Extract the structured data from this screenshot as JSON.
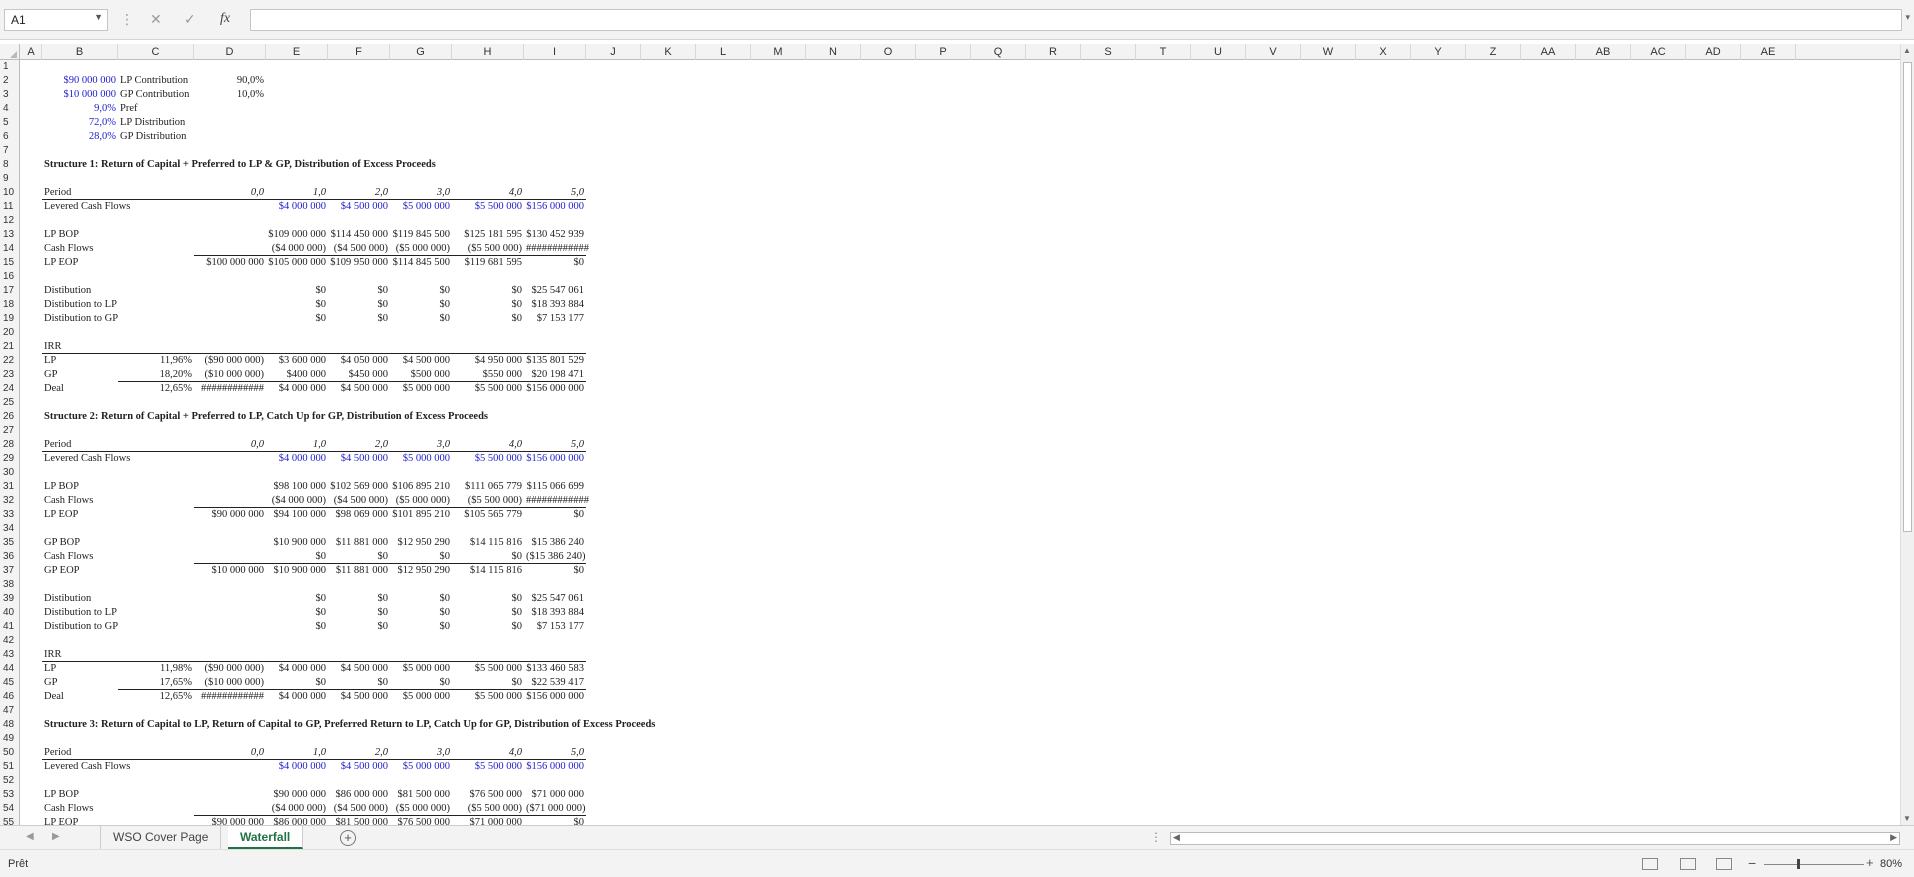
{
  "formula_bar": {
    "name_box": "A1",
    "fx": "fx",
    "formula": ""
  },
  "columns": [
    "A",
    "B",
    "C",
    "D",
    "E",
    "F",
    "G",
    "H",
    "I",
    "J",
    "K",
    "L",
    "M",
    "N",
    "O",
    "P",
    "Q",
    "R",
    "S",
    "T",
    "U",
    "V",
    "W",
    "X",
    "Y",
    "Z",
    "AA",
    "AB",
    "AC",
    "AD",
    "AE"
  ],
  "rows": [
    "1",
    "2",
    "3",
    "4",
    "5",
    "6",
    "7",
    "8",
    "9",
    "10",
    "11",
    "12",
    "13",
    "14",
    "15",
    "16",
    "17",
    "18",
    "19",
    "20",
    "21",
    "22",
    "23",
    "24",
    "25",
    "26",
    "27",
    "28",
    "29",
    "30",
    "31",
    "32",
    "33",
    "34",
    "35",
    "36",
    "37",
    "38",
    "39",
    "40",
    "41",
    "42",
    "43",
    "44",
    "45",
    "46",
    "47",
    "48",
    "49",
    "50",
    "51",
    "52",
    "53",
    "54",
    "55"
  ],
  "cells": [
    {
      "r": 2,
      "col": "B",
      "v": "$90 000 000",
      "cls": "num blue"
    },
    {
      "r": 2,
      "col": "C",
      "v": "LP Contribution"
    },
    {
      "r": 2,
      "col": "D",
      "v": "90,0%",
      "cls": "num"
    },
    {
      "r": 3,
      "col": "B",
      "v": "$10 000 000",
      "cls": "num blue"
    },
    {
      "r": 3,
      "col": "C",
      "v": "GP Contribution"
    },
    {
      "r": 3,
      "col": "D",
      "v": "10,0%",
      "cls": "num"
    },
    {
      "r": 4,
      "col": "B",
      "v": "9,0%",
      "cls": "num blue"
    },
    {
      "r": 4,
      "col": "C",
      "v": "Pref"
    },
    {
      "r": 5,
      "col": "B",
      "v": "72,0%",
      "cls": "num blue"
    },
    {
      "r": 5,
      "col": "C",
      "v": "LP Distribution"
    },
    {
      "r": 6,
      "col": "B",
      "v": "28,0%",
      "cls": "num blue"
    },
    {
      "r": 6,
      "col": "C",
      "v": "GP Distribution"
    },
    {
      "r": 8,
      "col": "B",
      "v": "Structure 1: Return of Capital + Preferred to LP & GP, Distribution of Excess Proceeds",
      "cls": "title"
    },
    {
      "r": 10,
      "col": "B",
      "v": "Period"
    },
    {
      "r": 10,
      "col": "D",
      "v": "0,0",
      "cls": "num it"
    },
    {
      "r": 10,
      "col": "E",
      "v": "1,0",
      "cls": "num it"
    },
    {
      "r": 10,
      "col": "F",
      "v": "2,0",
      "cls": "num it"
    },
    {
      "r": 10,
      "col": "G",
      "v": "3,0",
      "cls": "num it"
    },
    {
      "r": 10,
      "col": "H",
      "v": "4,0",
      "cls": "num it"
    },
    {
      "r": 10,
      "col": "I",
      "v": "5,0",
      "cls": "num it"
    },
    {
      "r": 11,
      "col": "B",
      "v": "Levered Cash Flows"
    },
    {
      "r": 11,
      "col": "E",
      "v": "$4 000 000",
      "cls": "num blue"
    },
    {
      "r": 11,
      "col": "F",
      "v": "$4 500 000",
      "cls": "num blue"
    },
    {
      "r": 11,
      "col": "G",
      "v": "$5 000 000",
      "cls": "num blue"
    },
    {
      "r": 11,
      "col": "H",
      "v": "$5 500 000",
      "cls": "num blue"
    },
    {
      "r": 11,
      "col": "I",
      "v": "$156 000 000",
      "cls": "num blue"
    },
    {
      "r": 13,
      "col": "B",
      "v": "LP BOP"
    },
    {
      "r": 13,
      "col": "E",
      "v": "$109 000 000",
      "cls": "num"
    },
    {
      "r": 13,
      "col": "F",
      "v": "$114 450 000",
      "cls": "num"
    },
    {
      "r": 13,
      "col": "G",
      "v": "$119 845 500",
      "cls": "num"
    },
    {
      "r": 13,
      "col": "H",
      "v": "$125 181 595",
      "cls": "num"
    },
    {
      "r": 13,
      "col": "I",
      "v": "$130 452 939",
      "cls": "num"
    },
    {
      "r": 14,
      "col": "B",
      "v": "Cash Flows"
    },
    {
      "r": 14,
      "col": "E",
      "v": "($4 000 000)",
      "cls": "num"
    },
    {
      "r": 14,
      "col": "F",
      "v": "($4 500 000)",
      "cls": "num"
    },
    {
      "r": 14,
      "col": "G",
      "v": "($5 000 000)",
      "cls": "num"
    },
    {
      "r": 14,
      "col": "H",
      "v": "($5 500 000)",
      "cls": "num"
    },
    {
      "r": 14,
      "col": "I",
      "v": "############",
      "cls": "num"
    },
    {
      "r": 15,
      "col": "B",
      "v": "LP EOP"
    },
    {
      "r": 15,
      "col": "D",
      "v": "$100 000 000",
      "cls": "num"
    },
    {
      "r": 15,
      "col": "E",
      "v": "$105 000 000",
      "cls": "num"
    },
    {
      "r": 15,
      "col": "F",
      "v": "$109 950 000",
      "cls": "num"
    },
    {
      "r": 15,
      "col": "G",
      "v": "$114 845 500",
      "cls": "num"
    },
    {
      "r": 15,
      "col": "H",
      "v": "$119 681 595",
      "cls": "num"
    },
    {
      "r": 15,
      "col": "I",
      "v": "$0",
      "cls": "num"
    },
    {
      "r": 17,
      "col": "B",
      "v": "Distibution"
    },
    {
      "r": 17,
      "col": "E",
      "v": "$0",
      "cls": "num"
    },
    {
      "r": 17,
      "col": "F",
      "v": "$0",
      "cls": "num"
    },
    {
      "r": 17,
      "col": "G",
      "v": "$0",
      "cls": "num"
    },
    {
      "r": 17,
      "col": "H",
      "v": "$0",
      "cls": "num"
    },
    {
      "r": 17,
      "col": "I",
      "v": "$25 547 061",
      "cls": "num"
    },
    {
      "r": 18,
      "col": "B",
      "v": "Distibution to LP"
    },
    {
      "r": 18,
      "col": "E",
      "v": "$0",
      "cls": "num"
    },
    {
      "r": 18,
      "col": "F",
      "v": "$0",
      "cls": "num"
    },
    {
      "r": 18,
      "col": "G",
      "v": "$0",
      "cls": "num"
    },
    {
      "r": 18,
      "col": "H",
      "v": "$0",
      "cls": "num"
    },
    {
      "r": 18,
      "col": "I",
      "v": "$18 393 884",
      "cls": "num"
    },
    {
      "r": 19,
      "col": "B",
      "v": "Distibution to GP"
    },
    {
      "r": 19,
      "col": "E",
      "v": "$0",
      "cls": "num"
    },
    {
      "r": 19,
      "col": "F",
      "v": "$0",
      "cls": "num"
    },
    {
      "r": 19,
      "col": "G",
      "v": "$0",
      "cls": "num"
    },
    {
      "r": 19,
      "col": "H",
      "v": "$0",
      "cls": "num"
    },
    {
      "r": 19,
      "col": "I",
      "v": "$7 153 177",
      "cls": "num"
    },
    {
      "r": 21,
      "col": "B",
      "v": "IRR"
    },
    {
      "r": 22,
      "col": "B",
      "v": "LP"
    },
    {
      "r": 22,
      "col": "C",
      "v": "11,96%",
      "cls": "num"
    },
    {
      "r": 22,
      "col": "D",
      "v": "($90 000 000)",
      "cls": "num"
    },
    {
      "r": 22,
      "col": "E",
      "v": "$3 600 000",
      "cls": "num"
    },
    {
      "r": 22,
      "col": "F",
      "v": "$4 050 000",
      "cls": "num"
    },
    {
      "r": 22,
      "col": "G",
      "v": "$4 500 000",
      "cls": "num"
    },
    {
      "r": 22,
      "col": "H",
      "v": "$4 950 000",
      "cls": "num"
    },
    {
      "r": 22,
      "col": "I",
      "v": "$135 801 529",
      "cls": "num"
    },
    {
      "r": 23,
      "col": "B",
      "v": "GP"
    },
    {
      "r": 23,
      "col": "C",
      "v": "18,20%",
      "cls": "num"
    },
    {
      "r": 23,
      "col": "D",
      "v": "($10 000 000)",
      "cls": "num"
    },
    {
      "r": 23,
      "col": "E",
      "v": "$400 000",
      "cls": "num"
    },
    {
      "r": 23,
      "col": "F",
      "v": "$450 000",
      "cls": "num"
    },
    {
      "r": 23,
      "col": "G",
      "v": "$500 000",
      "cls": "num"
    },
    {
      "r": 23,
      "col": "H",
      "v": "$550 000",
      "cls": "num"
    },
    {
      "r": 23,
      "col": "I",
      "v": "$20 198 471",
      "cls": "num"
    },
    {
      "r": 24,
      "col": "B",
      "v": "Deal"
    },
    {
      "r": 24,
      "col": "C",
      "v": "12,65%",
      "cls": "num"
    },
    {
      "r": 24,
      "col": "D",
      "v": "############",
      "cls": "num"
    },
    {
      "r": 24,
      "col": "E",
      "v": "$4 000 000",
      "cls": "num"
    },
    {
      "r": 24,
      "col": "F",
      "v": "$4 500 000",
      "cls": "num"
    },
    {
      "r": 24,
      "col": "G",
      "v": "$5 000 000",
      "cls": "num"
    },
    {
      "r": 24,
      "col": "H",
      "v": "$5 500 000",
      "cls": "num"
    },
    {
      "r": 24,
      "col": "I",
      "v": "$156 000 000",
      "cls": "num"
    },
    {
      "r": 26,
      "col": "B",
      "v": "Structure 2: Return of Capital + Preferred to LP, Catch Up for GP, Distribution of Excess Proceeds",
      "cls": "title"
    },
    {
      "r": 28,
      "col": "B",
      "v": "Period"
    },
    {
      "r": 28,
      "col": "D",
      "v": "0,0",
      "cls": "num it"
    },
    {
      "r": 28,
      "col": "E",
      "v": "1,0",
      "cls": "num it"
    },
    {
      "r": 28,
      "col": "F",
      "v": "2,0",
      "cls": "num it"
    },
    {
      "r": 28,
      "col": "G",
      "v": "3,0",
      "cls": "num it"
    },
    {
      "r": 28,
      "col": "H",
      "v": "4,0",
      "cls": "num it"
    },
    {
      "r": 28,
      "col": "I",
      "v": "5,0",
      "cls": "num it"
    },
    {
      "r": 29,
      "col": "B",
      "v": "Levered Cash Flows"
    },
    {
      "r": 29,
      "col": "E",
      "v": "$4 000 000",
      "cls": "num blue"
    },
    {
      "r": 29,
      "col": "F",
      "v": "$4 500 000",
      "cls": "num blue"
    },
    {
      "r": 29,
      "col": "G",
      "v": "$5 000 000",
      "cls": "num blue"
    },
    {
      "r": 29,
      "col": "H",
      "v": "$5 500 000",
      "cls": "num blue"
    },
    {
      "r": 29,
      "col": "I",
      "v": "$156 000 000",
      "cls": "num blue"
    },
    {
      "r": 31,
      "col": "B",
      "v": "LP BOP"
    },
    {
      "r": 31,
      "col": "E",
      "v": "$98 100 000",
      "cls": "num"
    },
    {
      "r": 31,
      "col": "F",
      "v": "$102 569 000",
      "cls": "num"
    },
    {
      "r": 31,
      "col": "G",
      "v": "$106 895 210",
      "cls": "num"
    },
    {
      "r": 31,
      "col": "H",
      "v": "$111 065 779",
      "cls": "num"
    },
    {
      "r": 31,
      "col": "I",
      "v": "$115 066 699",
      "cls": "num"
    },
    {
      "r": 32,
      "col": "B",
      "v": "Cash Flows"
    },
    {
      "r": 32,
      "col": "E",
      "v": "($4 000 000)",
      "cls": "num"
    },
    {
      "r": 32,
      "col": "F",
      "v": "($4 500 000)",
      "cls": "num"
    },
    {
      "r": 32,
      "col": "G",
      "v": "($5 000 000)",
      "cls": "num"
    },
    {
      "r": 32,
      "col": "H",
      "v": "($5 500 000)",
      "cls": "num"
    },
    {
      "r": 32,
      "col": "I",
      "v": "############",
      "cls": "num"
    },
    {
      "r": 33,
      "col": "B",
      "v": "LP EOP"
    },
    {
      "r": 33,
      "col": "D",
      "v": "$90 000 000",
      "cls": "num"
    },
    {
      "r": 33,
      "col": "E",
      "v": "$94 100 000",
      "cls": "num"
    },
    {
      "r": 33,
      "col": "F",
      "v": "$98 069 000",
      "cls": "num"
    },
    {
      "r": 33,
      "col": "G",
      "v": "$101 895 210",
      "cls": "num"
    },
    {
      "r": 33,
      "col": "H",
      "v": "$105 565 779",
      "cls": "num"
    },
    {
      "r": 33,
      "col": "I",
      "v": "$0",
      "cls": "num"
    },
    {
      "r": 35,
      "col": "B",
      "v": "GP BOP"
    },
    {
      "r": 35,
      "col": "E",
      "v": "$10 900 000",
      "cls": "num"
    },
    {
      "r": 35,
      "col": "F",
      "v": "$11 881 000",
      "cls": "num"
    },
    {
      "r": 35,
      "col": "G",
      "v": "$12 950 290",
      "cls": "num"
    },
    {
      "r": 35,
      "col": "H",
      "v": "$14 115 816",
      "cls": "num"
    },
    {
      "r": 35,
      "col": "I",
      "v": "$15 386 240",
      "cls": "num"
    },
    {
      "r": 36,
      "col": "B",
      "v": "Cash Flows"
    },
    {
      "r": 36,
      "col": "E",
      "v": "$0",
      "cls": "num"
    },
    {
      "r": 36,
      "col": "F",
      "v": "$0",
      "cls": "num"
    },
    {
      "r": 36,
      "col": "G",
      "v": "$0",
      "cls": "num"
    },
    {
      "r": 36,
      "col": "H",
      "v": "$0",
      "cls": "num"
    },
    {
      "r": 36,
      "col": "I",
      "v": "($15 386 240)",
      "cls": "num"
    },
    {
      "r": 37,
      "col": "B",
      "v": "GP EOP"
    },
    {
      "r": 37,
      "col": "D",
      "v": "$10 000 000",
      "cls": "num"
    },
    {
      "r": 37,
      "col": "E",
      "v": "$10 900 000",
      "cls": "num"
    },
    {
      "r": 37,
      "col": "F",
      "v": "$11 881 000",
      "cls": "num"
    },
    {
      "r": 37,
      "col": "G",
      "v": "$12 950 290",
      "cls": "num"
    },
    {
      "r": 37,
      "col": "H",
      "v": "$14 115 816",
      "cls": "num"
    },
    {
      "r": 37,
      "col": "I",
      "v": "$0",
      "cls": "num"
    },
    {
      "r": 39,
      "col": "B",
      "v": "Distibution"
    },
    {
      "r": 39,
      "col": "E",
      "v": "$0",
      "cls": "num"
    },
    {
      "r": 39,
      "col": "F",
      "v": "$0",
      "cls": "num"
    },
    {
      "r": 39,
      "col": "G",
      "v": "$0",
      "cls": "num"
    },
    {
      "r": 39,
      "col": "H",
      "v": "$0",
      "cls": "num"
    },
    {
      "r": 39,
      "col": "I",
      "v": "$25 547 061",
      "cls": "num"
    },
    {
      "r": 40,
      "col": "B",
      "v": "Distibution to LP"
    },
    {
      "r": 40,
      "col": "E",
      "v": "$0",
      "cls": "num"
    },
    {
      "r": 40,
      "col": "F",
      "v": "$0",
      "cls": "num"
    },
    {
      "r": 40,
      "col": "G",
      "v": "$0",
      "cls": "num"
    },
    {
      "r": 40,
      "col": "H",
      "v": "$0",
      "cls": "num"
    },
    {
      "r": 40,
      "col": "I",
      "v": "$18 393 884",
      "cls": "num"
    },
    {
      "r": 41,
      "col": "B",
      "v": "Distibution to GP"
    },
    {
      "r": 41,
      "col": "E",
      "v": "$0",
      "cls": "num"
    },
    {
      "r": 41,
      "col": "F",
      "v": "$0",
      "cls": "num"
    },
    {
      "r": 41,
      "col": "G",
      "v": "$0",
      "cls": "num"
    },
    {
      "r": 41,
      "col": "H",
      "v": "$0",
      "cls": "num"
    },
    {
      "r": 41,
      "col": "I",
      "v": "$7 153 177",
      "cls": "num"
    },
    {
      "r": 43,
      "col": "B",
      "v": "IRR"
    },
    {
      "r": 44,
      "col": "B",
      "v": "LP"
    },
    {
      "r": 44,
      "col": "C",
      "v": "11,98%",
      "cls": "num"
    },
    {
      "r": 44,
      "col": "D",
      "v": "($90 000 000)",
      "cls": "num"
    },
    {
      "r": 44,
      "col": "E",
      "v": "$4 000 000",
      "cls": "num"
    },
    {
      "r": 44,
      "col": "F",
      "v": "$4 500 000",
      "cls": "num"
    },
    {
      "r": 44,
      "col": "G",
      "v": "$5 000 000",
      "cls": "num"
    },
    {
      "r": 44,
      "col": "H",
      "v": "$5 500 000",
      "cls": "num"
    },
    {
      "r": 44,
      "col": "I",
      "v": "$133 460 583",
      "cls": "num"
    },
    {
      "r": 45,
      "col": "B",
      "v": "GP"
    },
    {
      "r": 45,
      "col": "C",
      "v": "17,65%",
      "cls": "num"
    },
    {
      "r": 45,
      "col": "D",
      "v": "($10 000 000)",
      "cls": "num"
    },
    {
      "r": 45,
      "col": "E",
      "v": "$0",
      "cls": "num"
    },
    {
      "r": 45,
      "col": "F",
      "v": "$0",
      "cls": "num"
    },
    {
      "r": 45,
      "col": "G",
      "v": "$0",
      "cls": "num"
    },
    {
      "r": 45,
      "col": "H",
      "v": "$0",
      "cls": "num"
    },
    {
      "r": 45,
      "col": "I",
      "v": "$22 539 417",
      "cls": "num"
    },
    {
      "r": 46,
      "col": "B",
      "v": "Deal"
    },
    {
      "r": 46,
      "col": "C",
      "v": "12,65%",
      "cls": "num"
    },
    {
      "r": 46,
      "col": "D",
      "v": "############",
      "cls": "num"
    },
    {
      "r": 46,
      "col": "E",
      "v": "$4 000 000",
      "cls": "num"
    },
    {
      "r": 46,
      "col": "F",
      "v": "$4 500 000",
      "cls": "num"
    },
    {
      "r": 46,
      "col": "G",
      "v": "$5 000 000",
      "cls": "num"
    },
    {
      "r": 46,
      "col": "H",
      "v": "$5 500 000",
      "cls": "num"
    },
    {
      "r": 46,
      "col": "I",
      "v": "$156 000 000",
      "cls": "num"
    },
    {
      "r": 48,
      "col": "B",
      "v": "Structure 3: Return of Capital to LP, Return of Capital to GP, Preferred Return to LP, Catch Up for GP, Distribution of Excess Proceeds",
      "cls": "title"
    },
    {
      "r": 50,
      "col": "B",
      "v": "Period"
    },
    {
      "r": 50,
      "col": "D",
      "v": "0,0",
      "cls": "num it"
    },
    {
      "r": 50,
      "col": "E",
      "v": "1,0",
      "cls": "num it"
    },
    {
      "r": 50,
      "col": "F",
      "v": "2,0",
      "cls": "num it"
    },
    {
      "r": 50,
      "col": "G",
      "v": "3,0",
      "cls": "num it"
    },
    {
      "r": 50,
      "col": "H",
      "v": "4,0",
      "cls": "num it"
    },
    {
      "r": 50,
      "col": "I",
      "v": "5,0",
      "cls": "num it"
    },
    {
      "r": 51,
      "col": "B",
      "v": "Levered Cash Flows"
    },
    {
      "r": 51,
      "col": "E",
      "v": "$4 000 000",
      "cls": "num blue"
    },
    {
      "r": 51,
      "col": "F",
      "v": "$4 500 000",
      "cls": "num blue"
    },
    {
      "r": 51,
      "col": "G",
      "v": "$5 000 000",
      "cls": "num blue"
    },
    {
      "r": 51,
      "col": "H",
      "v": "$5 500 000",
      "cls": "num blue"
    },
    {
      "r": 51,
      "col": "I",
      "v": "$156 000 000",
      "cls": "num blue"
    },
    {
      "r": 53,
      "col": "B",
      "v": "LP BOP"
    },
    {
      "r": 53,
      "col": "E",
      "v": "$90 000 000",
      "cls": "num"
    },
    {
      "r": 53,
      "col": "F",
      "v": "$86 000 000",
      "cls": "num"
    },
    {
      "r": 53,
      "col": "G",
      "v": "$81 500 000",
      "cls": "num"
    },
    {
      "r": 53,
      "col": "H",
      "v": "$76 500 000",
      "cls": "num"
    },
    {
      "r": 53,
      "col": "I",
      "v": "$71 000 000",
      "cls": "num"
    },
    {
      "r": 54,
      "col": "B",
      "v": "Cash Flows"
    },
    {
      "r": 54,
      "col": "E",
      "v": "($4 000 000)",
      "cls": "num"
    },
    {
      "r": 54,
      "col": "F",
      "v": "($4 500 000)",
      "cls": "num"
    },
    {
      "r": 54,
      "col": "G",
      "v": "($5 000 000)",
      "cls": "num"
    },
    {
      "r": 54,
      "col": "H",
      "v": "($5 500 000)",
      "cls": "num"
    },
    {
      "r": 54,
      "col": "I",
      "v": "($71 000 000)",
      "cls": "num"
    },
    {
      "r": 55,
      "col": "B",
      "v": "LP EOP"
    },
    {
      "r": 55,
      "col": "D",
      "v": "$90 000 000",
      "cls": "num"
    },
    {
      "r": 55,
      "col": "E",
      "v": "$86 000 000",
      "cls": "num"
    },
    {
      "r": 55,
      "col": "F",
      "v": "$81 500 000",
      "cls": "num"
    },
    {
      "r": 55,
      "col": "G",
      "v": "$76 500 000",
      "cls": "num"
    },
    {
      "r": 55,
      "col": "H",
      "v": "$71 000 000",
      "cls": "num"
    },
    {
      "r": 55,
      "col": "I",
      "v": "$0",
      "cls": "num"
    }
  ],
  "sheet_tabs": {
    "first": "WSO Cover Page",
    "second": "Waterfall",
    "active": "Waterfall",
    "add": "+"
  },
  "status": {
    "text": "Prêt",
    "zoom": "80%"
  },
  "colors": {
    "input_blue": "#2222cc",
    "excel_green": "#217346"
  }
}
